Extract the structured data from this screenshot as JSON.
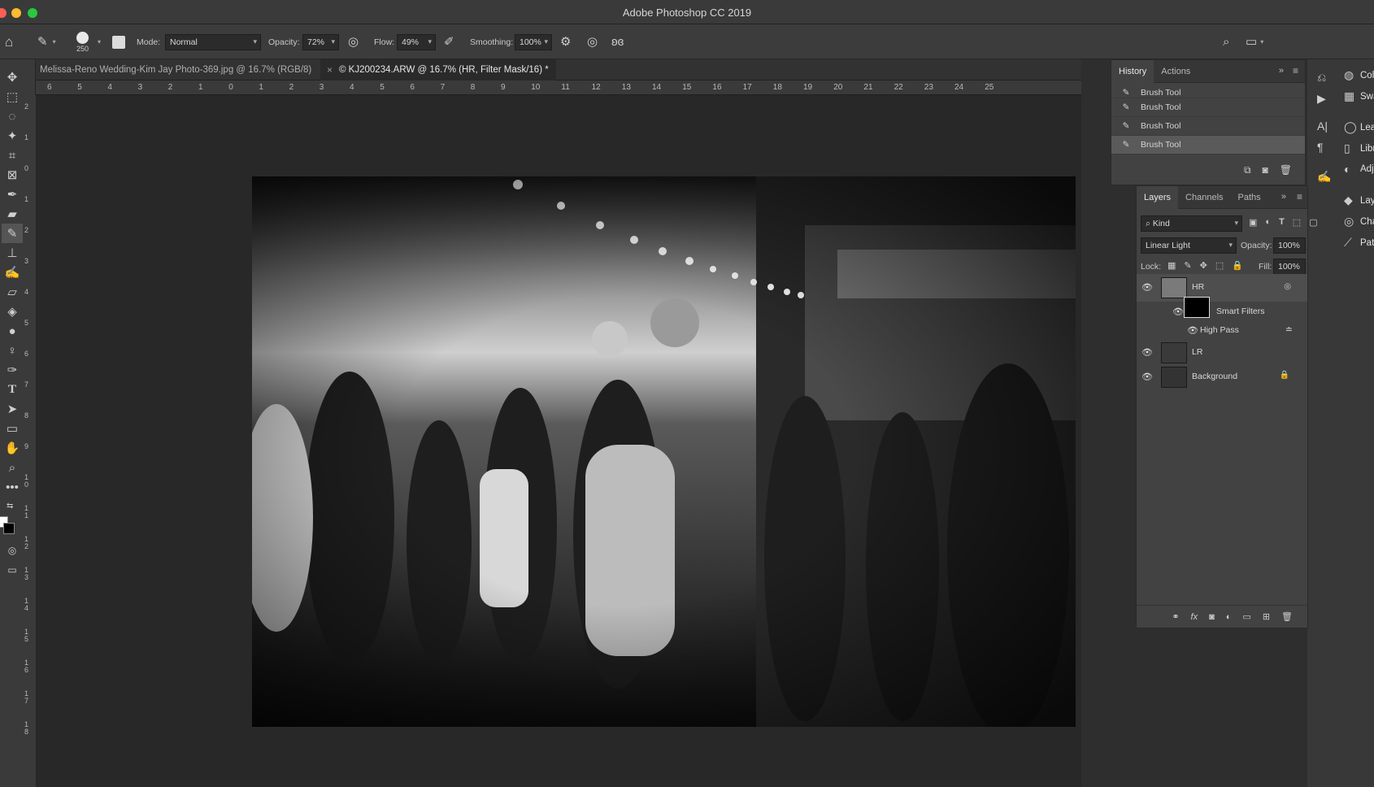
{
  "app": {
    "title": "Adobe Photoshop CC 2019"
  },
  "options": {
    "brush_size": "250",
    "mode_label": "Mode:",
    "mode_value": "Normal",
    "opacity_label": "Opacity:",
    "opacity_value": "72%",
    "flow_label": "Flow:",
    "flow_value": "49%",
    "smoothing_label": "Smoothing:",
    "smoothing_value": "100%"
  },
  "tabs": [
    {
      "label": "Melissa-Reno Wedding-Kim Jay Photo-369.jpg @ 16.7% (RGB/8)"
    },
    {
      "label": "© KJ200234.ARW @ 16.7% (HR, Filter Mask/16) *"
    }
  ],
  "ruler": {
    "h": [
      "6",
      "5",
      "4",
      "3",
      "2",
      "1",
      "0",
      "1",
      "2",
      "3",
      "4",
      "5",
      "6",
      "7",
      "8",
      "9",
      "10",
      "11",
      "12",
      "13",
      "14",
      "15",
      "16",
      "17",
      "18",
      "19",
      "20",
      "21",
      "22",
      "23",
      "24",
      "25"
    ],
    "v": [
      "2",
      "1",
      "0",
      "1",
      "2",
      "3",
      "4",
      "5",
      "6",
      "7",
      "8",
      "9",
      "1 0",
      "1 1",
      "1 2",
      "1 3",
      "1 4",
      "1 5",
      "1 6",
      "1 7",
      "1 8"
    ]
  },
  "history": {
    "tabs": [
      "History",
      "Actions"
    ],
    "items": [
      "Brush Tool",
      "Brush Tool",
      "Brush Tool",
      "Brush Tool"
    ]
  },
  "layers": {
    "tabs": [
      "Layers",
      "Channels",
      "Paths"
    ],
    "filter_kind": "Kind",
    "blend_mode": "Linear Light",
    "opacity_label": "Opacity:",
    "opacity_value": "100%",
    "lock_label": "Lock:",
    "fill_label": "Fill:",
    "fill_value": "100%",
    "items": [
      {
        "name": "HR"
      },
      {
        "name": "Smart Filters"
      },
      {
        "name": "High Pass"
      },
      {
        "name": "LR"
      },
      {
        "name": "Background"
      }
    ]
  },
  "right_panels": [
    "Color",
    "Swatches",
    "Learn",
    "Libraries",
    "Adjustme",
    "Layers",
    "Channels",
    "Paths"
  ]
}
